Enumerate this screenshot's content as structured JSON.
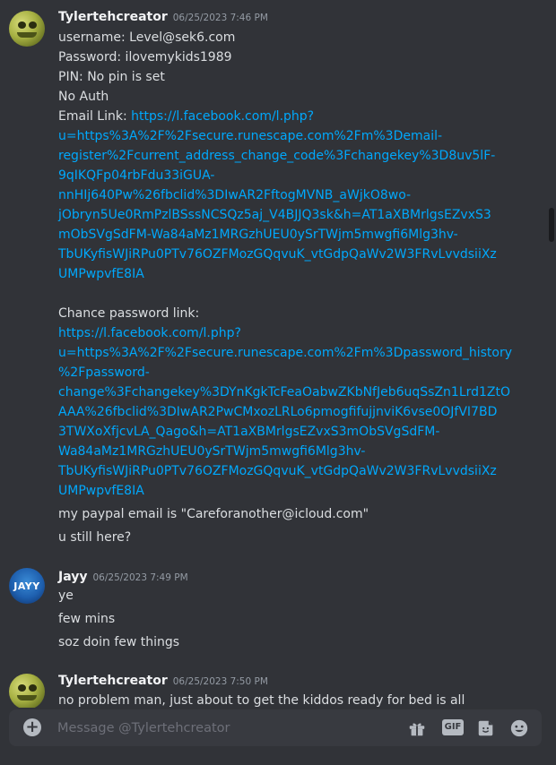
{
  "messages": [
    {
      "author": "Tylertehcreator",
      "time": "06/25/2023 7:46 PM",
      "avatar": "frog-avatar",
      "lines": [
        {
          "text": "username: Level@sek6.com"
        },
        {
          "text": "Password: ilovemykids1989"
        },
        {
          "text": "PIN: No pin is set"
        },
        {
          "text": "No Auth"
        },
        {
          "prefix": "Email Link: ",
          "link": "https://l.facebook.com/l.php?"
        },
        {
          "link": "u=https%3A%2F%2Fsecure.runescape.com%2Fm%3Demail-"
        },
        {
          "link": "register%2Fcurrent_address_change_code%3Fchangekey%3D8uv5lF-"
        },
        {
          "link": "9qIKQFp04rbFdu33iGUA-"
        },
        {
          "link": "nnHIj640Pw%26fbclid%3DIwAR2FftogMVNB_aWjkO8wo-"
        },
        {
          "link": "jObryn5Ue0RmPzlBSssNCSQz5aj_V4BJJQ3sk&h=AT1aXBMrlgsEZvxS3"
        },
        {
          "link": "mObSVgSdFM-Wa84aMz1MRGzhUEU0ySrTWjm5mwgfi6Mlg3hv-"
        },
        {
          "link": "TbUKyfisWJiRPu0PTv76OZFMozGQqvuK_vtGdpQaWv2W3FRvLvvdsiiXz"
        },
        {
          "link": "UMPwpvfE8IA"
        },
        {
          "text": ""
        },
        {
          "text": "Chance password link:"
        },
        {
          "link": "https://l.facebook.com/l.php?"
        },
        {
          "link": "u=https%3A%2F%2Fsecure.runescape.com%2Fm%3Dpassword_history"
        },
        {
          "link": "%2Fpassword-"
        },
        {
          "link": "change%3Fchangekey%3DYnKgkTcFeaOabwZKbNfJeb6uqSsZn1Lrd1ZtO"
        },
        {
          "link": "AAA%26fbclid%3DIwAR2PwCMxozLRLo6pmogfifujjnviK6vse0OJfVI7BD"
        },
        {
          "link": "3TWXoXfjcvLA_Qago&h=AT1aXBMrlgsEZvxS3mObSVgSdFM-"
        },
        {
          "link": "Wa84aMz1MRGzhUEU0ySrTWjm5mwgfi6Mlg3hv-"
        },
        {
          "link": "TbUKyfisWJiRPu0PTv76OZFMozGQqvuK_vtGdpQaWv2W3FRvLvvdsiiXz"
        },
        {
          "link": "UMPwpvfE8IA"
        }
      ],
      "followups": [
        "my paypal email is \"Careforanother@icloud.com\"",
        "u still here?"
      ]
    },
    {
      "author": "Jayy",
      "time": "06/25/2023 7:49 PM",
      "avatar": "jayy-avatar",
      "avatar_text": "JAYY",
      "followups": [
        "ye",
        "few mins",
        "soz doin few things"
      ]
    },
    {
      "author": "Tylertehcreator",
      "time": "06/25/2023 7:50 PM",
      "avatar": "frog-avatar",
      "followups": [
        "no problem man, just about to get the kiddos ready for bed is all"
      ]
    }
  ],
  "composer": {
    "placeholder": "Message @Tylertehcreator",
    "plus_icon": "plus-circle-icon",
    "gift_icon": "gift-icon",
    "gif_label": "GIF",
    "sticker_icon": "sticker-icon",
    "emoji_icon": "emoji-icon"
  },
  "colors": {
    "background": "#313338",
    "link": "#00a8fc",
    "composer": "#383a40",
    "text": "#dbdee1"
  }
}
